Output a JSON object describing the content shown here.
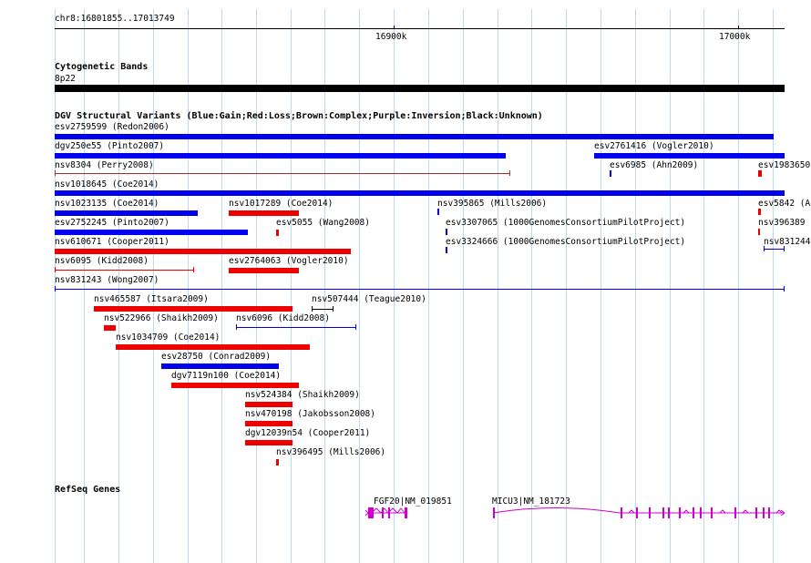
{
  "browser": {
    "region_label": "chr8:16801855..17013749",
    "ruler_ticks": [
      "16900k",
      "17000k"
    ]
  },
  "tracks": {
    "cytoband": {
      "title": "Cytogenetic Bands",
      "band_label": "8p22"
    },
    "dgv": {
      "title": "DGV Structural Variants (Blue:Gain;Red:Loss;Brown:Complex;Purple:Inversion;Black:Unknown)",
      "colors": {
        "gain": "#0000ee",
        "loss": "#ee0000",
        "complex": "#a52a2a",
        "inversion": "#cc00cc",
        "unknown": "#000000"
      },
      "features": [
        {
          "id": "esv2759599",
          "label": "esv2759599 (Redon2006)",
          "type": "gain"
        },
        {
          "id": "dgv250e55",
          "label": "dgv250e55 (Pinto2007)",
          "type": "gain"
        },
        {
          "id": "esv2761416",
          "label": "esv2761416 (Vogler2010)",
          "type": "gain"
        },
        {
          "id": "nsv8304",
          "label": "nsv8304 (Perry2008)",
          "type": "complex"
        },
        {
          "id": "esv6985",
          "label": "esv6985 (Ahn2009)",
          "type": "gain"
        },
        {
          "id": "esv1983650",
          "label": "esv1983650",
          "type": "loss"
        },
        {
          "id": "nsv1018645",
          "label": "nsv1018645 (Coe2014)",
          "type": "gain"
        },
        {
          "id": "nsv1023135",
          "label": "nsv1023135 (Coe2014)",
          "type": "gain"
        },
        {
          "id": "nsv1017289",
          "label": "nsv1017289 (Coe2014)",
          "type": "loss"
        },
        {
          "id": "nsv395865",
          "label": "nsv395865 (Mills2006)",
          "type": "gain"
        },
        {
          "id": "esv5842",
          "label": "esv5842 (A",
          "type": "loss"
        },
        {
          "id": "esv2752245",
          "label": "esv2752245 (Pinto2007)",
          "type": "gain"
        },
        {
          "id": "esv5055",
          "label": "esv5055 (Wang2008)",
          "type": "loss"
        },
        {
          "id": "esv3307065",
          "label": "esv3307065 (1000GenomesConsortiumPilotProject)",
          "type": "gain"
        },
        {
          "id": "nsv396389",
          "label": "nsv396389",
          "type": "loss"
        },
        {
          "id": "nsv610671",
          "label": "nsv610671 (Cooper2011)",
          "type": "loss"
        },
        {
          "id": "esv3324666",
          "label": "esv3324666 (1000GenomesConsortiumPilotProject)",
          "type": "gain"
        },
        {
          "id": "nsv831244",
          "label": "nsv831244",
          "type": "gain"
        },
        {
          "id": "nsv6095",
          "label": "nsv6095 (Kidd2008)",
          "type": "loss"
        },
        {
          "id": "esv2764063",
          "label": "esv2764063 (Vogler2010)",
          "type": "loss"
        },
        {
          "id": "nsv831243",
          "label": "nsv831243 (Wong2007)",
          "type": "gain"
        },
        {
          "id": "nsv465587",
          "label": "nsv465587 (Itsara2009)",
          "type": "loss"
        },
        {
          "id": "nsv507444",
          "label": "nsv507444 (Teague2010)",
          "type": "unknown"
        },
        {
          "id": "nsv522966",
          "label": "nsv522966 (Shaikh2009)",
          "type": "loss"
        },
        {
          "id": "nsv6096",
          "label": "nsv6096 (Kidd2008)",
          "type": "gain"
        },
        {
          "id": "nsv1034709",
          "label": "nsv1034709 (Coe2014)",
          "type": "loss"
        },
        {
          "id": "esv28750",
          "label": "esv28750 (Conrad2009)",
          "type": "gain"
        },
        {
          "id": "dgv7119n100",
          "label": "dgv7119n100 (Coe2014)",
          "type": "loss"
        },
        {
          "id": "nsv524384",
          "label": "nsv524384 (Shaikh2009)",
          "type": "loss"
        },
        {
          "id": "nsv470198",
          "label": "nsv470198 (Jakobsson2008)",
          "type": "loss"
        },
        {
          "id": "dgv12039n54",
          "label": "dgv12039n54 (Cooper2011)",
          "type": "loss"
        },
        {
          "id": "nsv396495",
          "label": "nsv396495 (Mills2006)",
          "type": "loss"
        }
      ]
    },
    "refseq": {
      "title": "RefSeq Genes",
      "color": "#cc00cc",
      "genes": [
        {
          "id": "fgf20",
          "label": "FGF20|NM_019851"
        },
        {
          "id": "micu3",
          "label": "MICU3|NM_181723"
        }
      ]
    }
  }
}
